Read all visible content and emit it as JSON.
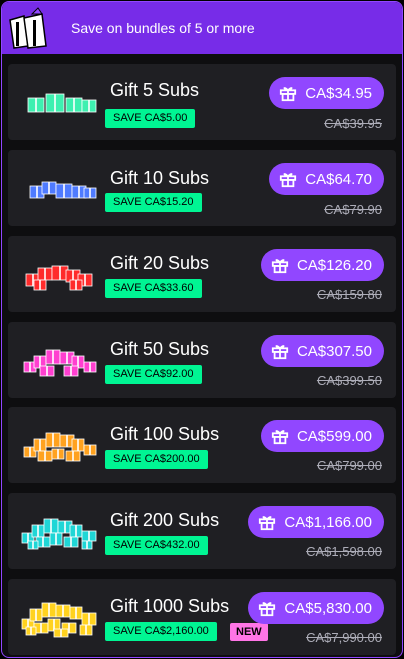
{
  "banner": {
    "text": "Save on bundles of 5 or more"
  },
  "bundles": [
    {
      "name": "Gift 5 Subs",
      "save": "SAVE CA$5.00",
      "price": "CA$34.95",
      "original": "CA$39.95",
      "color": "#3ef0b0"
    },
    {
      "name": "Gift 10 Subs",
      "save": "SAVE CA$15.20",
      "price": "CA$64.70",
      "original": "CA$79.90",
      "color": "#4f7bff"
    },
    {
      "name": "Gift 20 Subs",
      "save": "SAVE CA$33.60",
      "price": "CA$126.20",
      "original": "CA$159.80",
      "color": "#ff2b2b"
    },
    {
      "name": "Gift 50 Subs",
      "save": "SAVE CA$92.00",
      "price": "CA$307.50",
      "original": "CA$399.50",
      "color": "#ff3fd0"
    },
    {
      "name": "Gift 100 Subs",
      "save": "SAVE CA$200.00",
      "price": "CA$599.00",
      "original": "CA$799.00",
      "color": "#ffa21f"
    },
    {
      "name": "Gift 200 Subs",
      "save": "SAVE CA$432.00",
      "price": "CA$1,166.00",
      "original": "CA$1,598.00",
      "color": "#1fd6d6"
    },
    {
      "name": "Gift 1000 Subs",
      "save": "SAVE CA$2,160.00",
      "price": "CA$5,830.00",
      "original": "CA$7,990.00",
      "color": "#ffd21f",
      "badge": "NEW"
    }
  ]
}
